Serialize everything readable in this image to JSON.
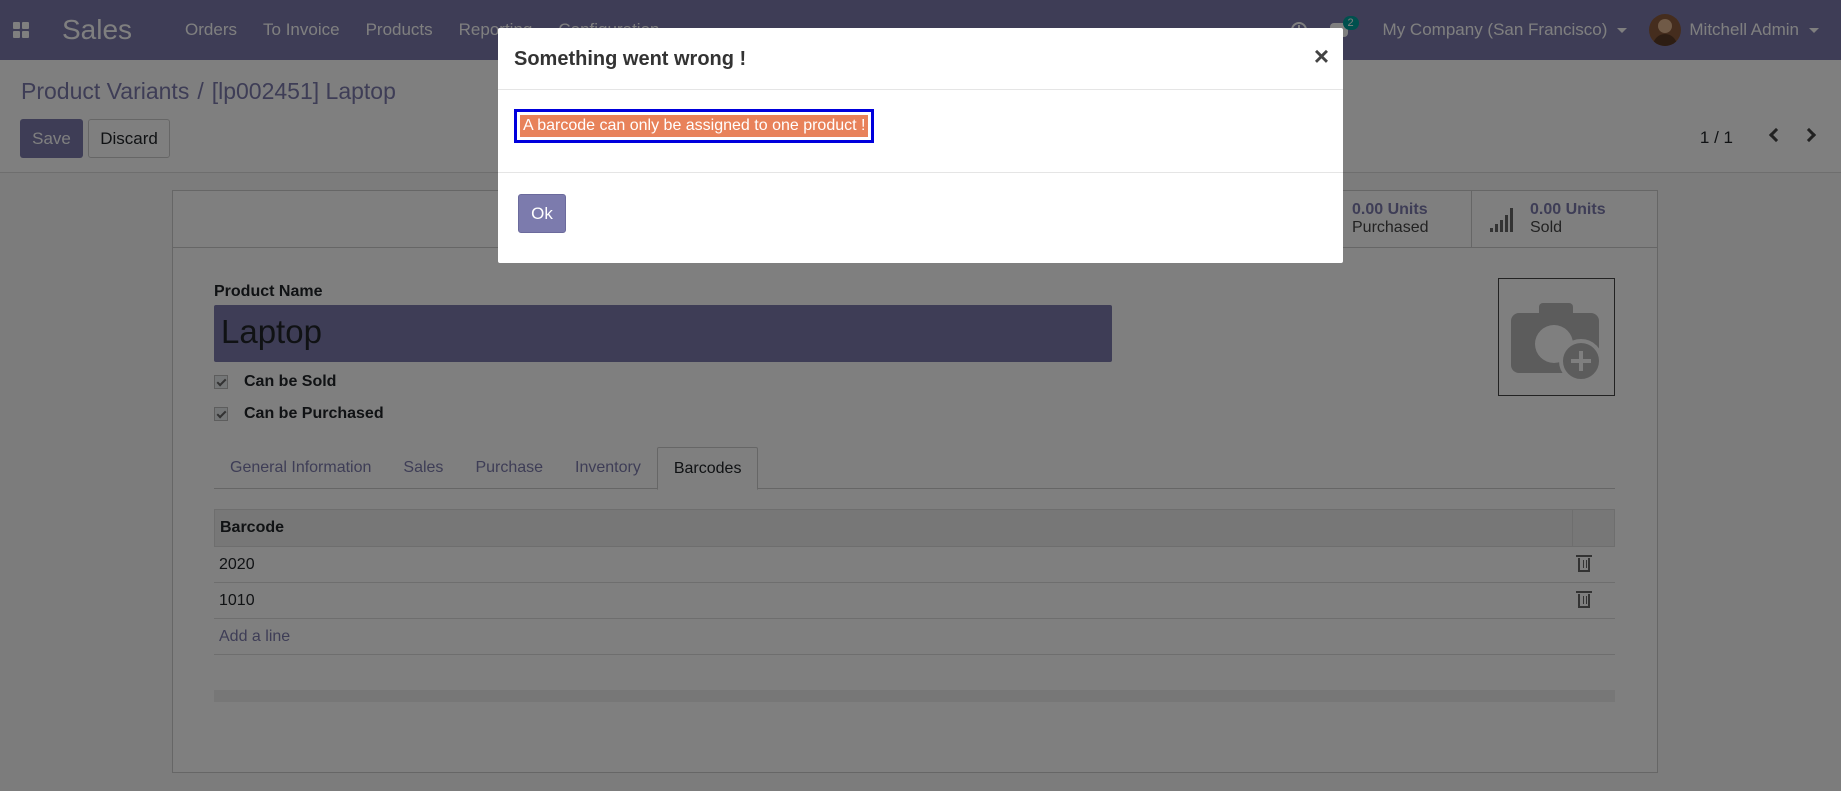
{
  "navbar": {
    "app_title": "Sales",
    "menu": [
      "Orders",
      "To Invoice",
      "Products",
      "Reporting",
      "Configuration"
    ],
    "chat_badge": "2",
    "company": "My Company (San Francisco)",
    "user": "Mitchell Admin"
  },
  "control": {
    "breadcrumb_parent": "Product Variants",
    "breadcrumb_sep": "/",
    "breadcrumb_current": "[lp002451] Laptop",
    "save_label": "Save",
    "discard_label": "Discard",
    "pager": "1 / 1"
  },
  "stats": [
    {
      "value": "0.00 Units",
      "label": "Purchased"
    },
    {
      "value": "0.00 Units",
      "label": "Sold"
    }
  ],
  "form": {
    "product_name_label": "Product Name",
    "product_name": "Laptop",
    "can_be_sold": "Can be Sold",
    "can_be_purchased": "Can be Purchased"
  },
  "tabs": [
    "General Information",
    "Sales",
    "Purchase",
    "Inventory",
    "Barcodes"
  ],
  "barcodes": {
    "header": "Barcode",
    "rows": [
      "2020",
      "1010"
    ],
    "add_line": "Add a line"
  },
  "dialog": {
    "title": "Something went wrong !",
    "close": "×",
    "message": "A barcode can only be assigned to one product !",
    "ok_label": "Ok"
  },
  "colors": {
    "primary": "#7c7bad",
    "highlight": "#e8825a",
    "focus_border": "#0000dd"
  }
}
